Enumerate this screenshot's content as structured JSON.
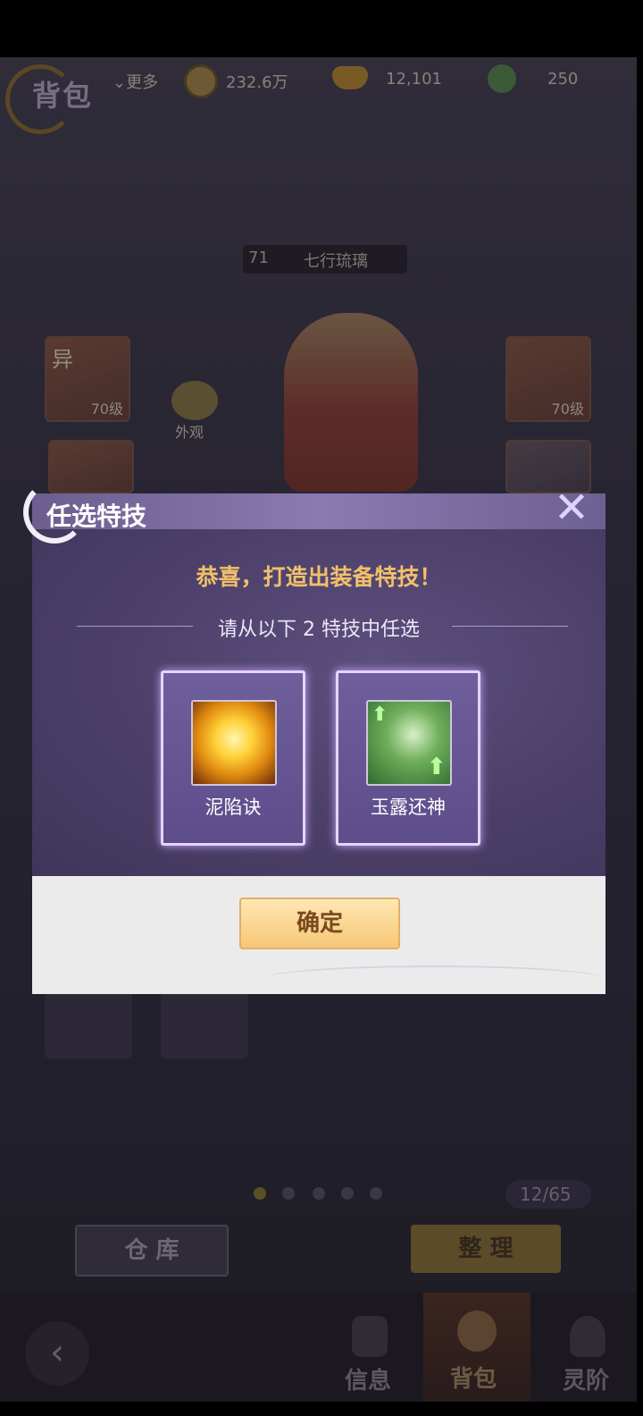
{
  "header": {
    "title": "背包",
    "more_label": "更多",
    "copper": "232.6万",
    "gold": "12,101",
    "jade": "250"
  },
  "character": {
    "level": "71",
    "name": "七行琉璃",
    "appearance_label": "外观"
  },
  "equipment": {
    "left_top_tag": "异",
    "left_top_level": "70级",
    "right_top_level": "70级"
  },
  "bag": {
    "page_count": "12/65",
    "warehouse_button": "仓 库",
    "sort_button": "整 理"
  },
  "bottom_nav": {
    "info": "信息",
    "bag": "背包",
    "spirit": "灵阶"
  },
  "dialog": {
    "title": "任选特技",
    "congrats": "恭喜，打造出装备特技！",
    "instruction": "请从以下 2 特技中任选",
    "skills": [
      {
        "name": "泥陷诀",
        "icon": "fire-skill-icon"
      },
      {
        "name": "玉露还神",
        "icon": "heal-skill-icon"
      }
    ],
    "confirm": "确定"
  },
  "colors": {
    "accent_gold": "#f2c06a",
    "dialog_purple": "#4b3f68",
    "skill_border": "#e6d3ff"
  }
}
